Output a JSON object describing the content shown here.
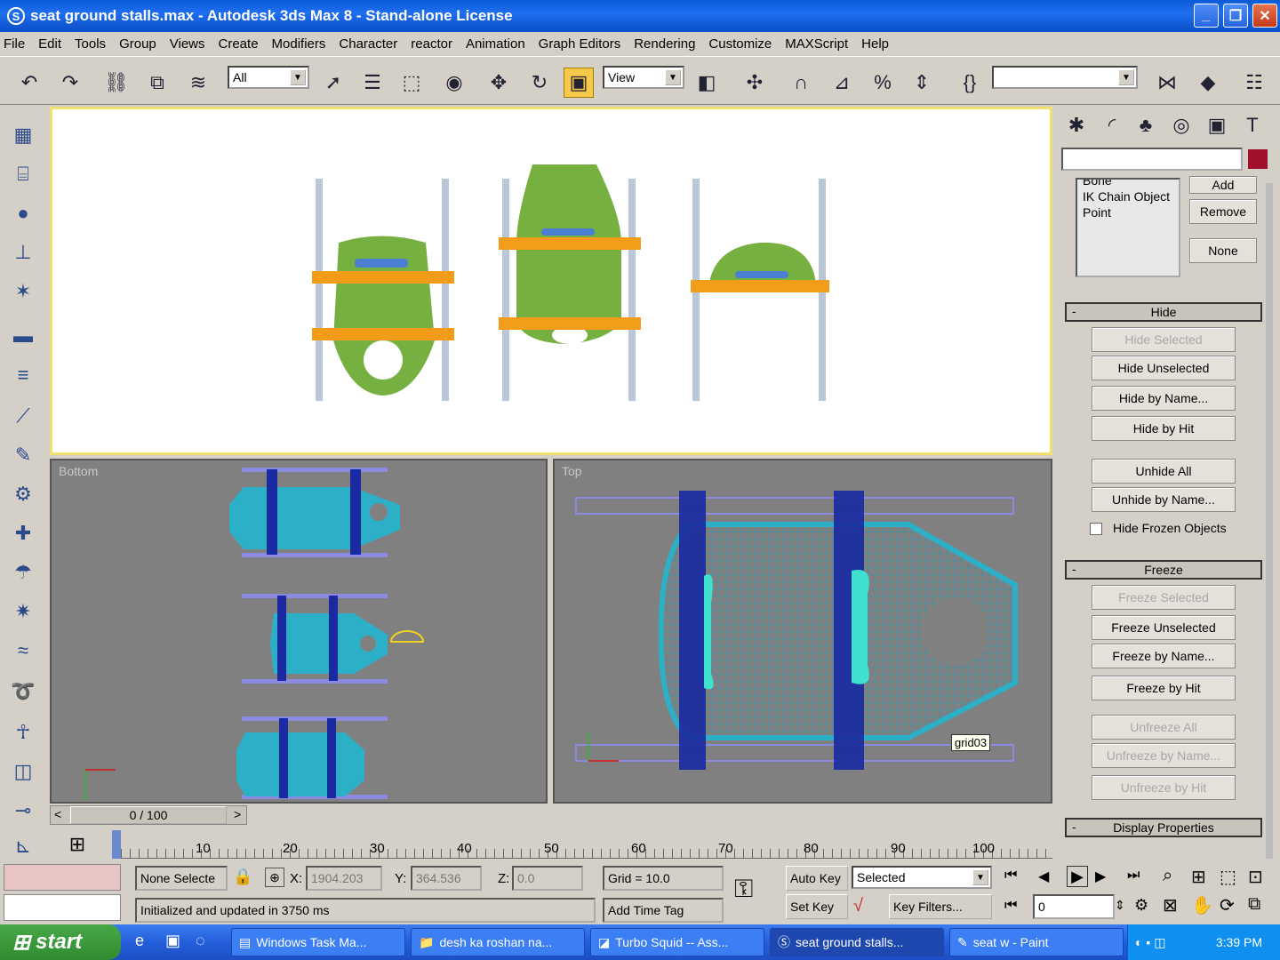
{
  "window": {
    "title": "seat ground stalls.max - Autodesk 3ds Max 8  - Stand-alone License"
  },
  "menu": [
    "File",
    "Edit",
    "Tools",
    "Group",
    "Views",
    "Create",
    "Modifiers",
    "Character",
    "reactor",
    "Animation",
    "Graph Editors",
    "Rendering",
    "Customize",
    "MAXScript",
    "Help"
  ],
  "toolbar": {
    "filter": "All",
    "refcoord": "View",
    "named_sel": ""
  },
  "viewports": {
    "bottom": "Bottom",
    "top": "Top",
    "grid_label": "grid03"
  },
  "panel": {
    "list_items": [
      "Bone",
      "IK Chain Object",
      "Point"
    ],
    "add": "Add",
    "remove": "Remove",
    "none": "None",
    "hide_title": "Hide",
    "hide_buttons": [
      "Hide Selected",
      "Hide Unselected",
      "Hide by Name...",
      "Hide by Hit"
    ],
    "unhide_buttons": [
      "Unhide All",
      "Unhide by Name..."
    ],
    "hide_frozen": "Hide Frozen Objects",
    "freeze_title": "Freeze",
    "freeze_buttons": [
      "Freeze Selected",
      "Freeze Unselected",
      "Freeze by Name...",
      "Freeze by Hit"
    ],
    "unfreeze_buttons": [
      "Unfreeze All",
      "Unfreeze by Name...",
      "Unfreeze by Hit"
    ],
    "display_title": "Display Properties"
  },
  "timeline": {
    "slider": "0 / 100",
    "ticks": [
      "10",
      "20",
      "30",
      "40",
      "50",
      "60",
      "70",
      "80",
      "90",
      "100"
    ]
  },
  "status": {
    "selection": "None Selecte",
    "x_label": "X:",
    "x": "1904.203",
    "y_label": "Y:",
    "y": "364.536",
    "z_label": "Z:",
    "z": "0.0",
    "grid": "Grid = 10.0",
    "message": "Initialized and updated in 3750 ms",
    "add_time_tag": "Add Time Tag",
    "auto_key": "Auto Key",
    "set_key": "Set Key",
    "key_mode": "Selected",
    "key_filters": "Key Filters...",
    "frame": "0"
  },
  "taskbar": {
    "start": "start",
    "tasks": [
      "Windows Task Ma...",
      "desh ka roshan na...",
      "Turbo Squid -- Ass...",
      "seat ground stalls...",
      "seat w - Paint"
    ],
    "clock": "3:39 PM"
  }
}
